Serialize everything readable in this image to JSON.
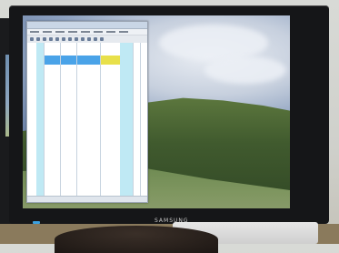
{
  "monitor": {
    "brand_label": "SAMSUNG"
  },
  "colors": {
    "spreadsheet_header_yellow": "#e8e04a",
    "spreadsheet_header_blue": "#4aa3e8",
    "spreadsheet_col_cyan": "#bfe9f4"
  }
}
